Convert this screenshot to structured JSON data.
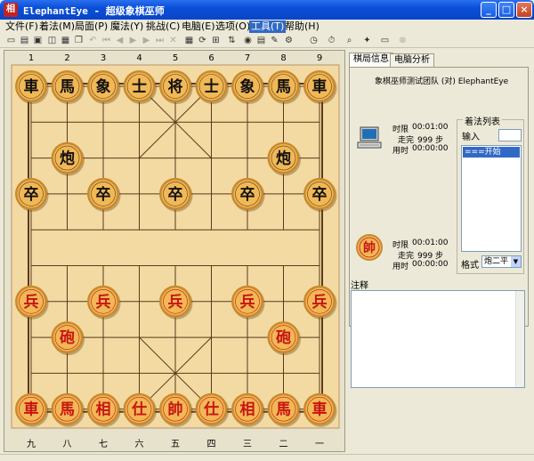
{
  "window": {
    "title": "ElephantEye - 超级象棋巫师",
    "icon_char": "相",
    "minimize": "_",
    "maximize": "□",
    "close": "×"
  },
  "menu": [
    {
      "label": "文件(F)"
    },
    {
      "label": "着法(M)"
    },
    {
      "label": "局面(P)"
    },
    {
      "label": "魔法(Y)"
    },
    {
      "label": "挑战(C)"
    },
    {
      "label": "电脑(E)"
    },
    {
      "label": "选项(O)"
    },
    {
      "label": "工具(T)"
    },
    {
      "label": "帮助(H)"
    }
  ],
  "toolbar_icons": [
    "new-icon",
    "open-icon",
    "save-icon",
    "print-preview-icon",
    "print-icon",
    "copy-icon",
    "undo-icon",
    "first-icon",
    "back-icon",
    "play-icon",
    "forward-icon",
    "last-icon",
    "delete-icon",
    "board-icon",
    "rotate-icon",
    "tree-icon",
    "flip-icon",
    "time-icon",
    "book-icon",
    "note-icon",
    "engine-icon",
    "clock-icon",
    "timer-icon",
    "analyze-icon",
    "idea-icon",
    "monitor-icon",
    "stop-icon"
  ],
  "board": {
    "file_labels_top": [
      "1",
      "2",
      "3",
      "4",
      "5",
      "6",
      "7",
      "8",
      "9"
    ],
    "file_labels_bottom": [
      "九",
      "八",
      "七",
      "六",
      "五",
      "四",
      "三",
      "二",
      "一"
    ],
    "colors": {
      "board": "#f3d9a2",
      "line": "#5a3a1a",
      "piece_face": "#f1b856",
      "piece_rim": "#c88a2c",
      "black_text": "#111111",
      "red_text": "#c81414"
    },
    "pieces": [
      {
        "c": "車",
        "s": "b",
        "f": 0,
        "r": 0
      },
      {
        "c": "馬",
        "s": "b",
        "f": 1,
        "r": 0
      },
      {
        "c": "象",
        "s": "b",
        "f": 2,
        "r": 0
      },
      {
        "c": "士",
        "s": "b",
        "f": 3,
        "r": 0
      },
      {
        "c": "将",
        "s": "b",
        "f": 4,
        "r": 0
      },
      {
        "c": "士",
        "s": "b",
        "f": 5,
        "r": 0
      },
      {
        "c": "象",
        "s": "b",
        "f": 6,
        "r": 0
      },
      {
        "c": "馬",
        "s": "b",
        "f": 7,
        "r": 0
      },
      {
        "c": "車",
        "s": "b",
        "f": 8,
        "r": 0
      },
      {
        "c": "炮",
        "s": "b",
        "f": 1,
        "r": 2
      },
      {
        "c": "炮",
        "s": "b",
        "f": 7,
        "r": 2
      },
      {
        "c": "卒",
        "s": "b",
        "f": 0,
        "r": 3
      },
      {
        "c": "卒",
        "s": "b",
        "f": 2,
        "r": 3
      },
      {
        "c": "卒",
        "s": "b",
        "f": 4,
        "r": 3
      },
      {
        "c": "卒",
        "s": "b",
        "f": 6,
        "r": 3
      },
      {
        "c": "卒",
        "s": "b",
        "f": 8,
        "r": 3
      },
      {
        "c": "兵",
        "s": "r",
        "f": 0,
        "r": 6
      },
      {
        "c": "兵",
        "s": "r",
        "f": 2,
        "r": 6
      },
      {
        "c": "兵",
        "s": "r",
        "f": 4,
        "r": 6
      },
      {
        "c": "兵",
        "s": "r",
        "f": 6,
        "r": 6
      },
      {
        "c": "兵",
        "s": "r",
        "f": 8,
        "r": 6
      },
      {
        "c": "砲",
        "s": "r",
        "f": 1,
        "r": 7
      },
      {
        "c": "砲",
        "s": "r",
        "f": 7,
        "r": 7
      },
      {
        "c": "車",
        "s": "r",
        "f": 0,
        "r": 9
      },
      {
        "c": "馬",
        "s": "r",
        "f": 1,
        "r": 9
      },
      {
        "c": "相",
        "s": "r",
        "f": 2,
        "r": 9
      },
      {
        "c": "仕",
        "s": "r",
        "f": 3,
        "r": 9
      },
      {
        "c": "帥",
        "s": "r",
        "f": 4,
        "r": 9
      },
      {
        "c": "仕",
        "s": "r",
        "f": 5,
        "r": 9
      },
      {
        "c": "相",
        "s": "r",
        "f": 6,
        "r": 9
      },
      {
        "c": "馬",
        "s": "r",
        "f": 7,
        "r": 9
      },
      {
        "c": "車",
        "s": "r",
        "f": 8,
        "r": 9
      }
    ]
  },
  "panel": {
    "tabs": [
      {
        "label": "棋局信息"
      },
      {
        "label": "电脑分析"
      }
    ],
    "match_title": "象棋巫师测试团队 (对) ElephantEye",
    "black": {
      "time_limit_label": "时限",
      "time_limit": "00:01:00",
      "moves_label": "走完",
      "moves_value": "999 步",
      "used_label": "用时",
      "used": "00:00:00"
    },
    "red": {
      "piece_char": "帥",
      "time_limit_label": "时限",
      "time_limit": "00:01:00",
      "moves_label": "走完",
      "moves_value": "999 步",
      "used_label": "用时",
      "used": "00:00:00"
    },
    "moves_group_title": "着法列表",
    "input_label": "输入",
    "input_value": "",
    "moves": [
      "===开始==="
    ],
    "format_label": "格式",
    "format_value": "炮二平",
    "notes_label": "注释",
    "notes_value": ""
  }
}
